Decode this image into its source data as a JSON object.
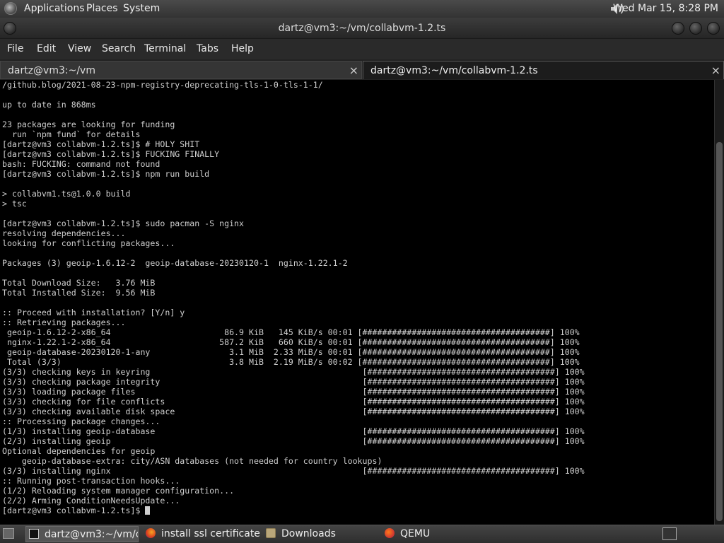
{
  "top_panel": {
    "menus": [
      "Applications",
      "Places",
      "System"
    ],
    "clock": "Wed Mar 15,  8:28 PM"
  },
  "window": {
    "title": "dartz@vm3:~/vm/collabvm-1.2.ts"
  },
  "menubar": [
    "File",
    "Edit",
    "View",
    "Search",
    "Terminal",
    "Tabs",
    "Help"
  ],
  "tabs": [
    {
      "label": "dartz@vm3:~/vm",
      "close": "×"
    },
    {
      "label": "dartz@vm3:~/vm/collabvm-1.2.ts",
      "close": "×"
    }
  ],
  "terminal": {
    "lines": [
      "/github.blog/2021-08-23-npm-registry-deprecating-tls-1-0-tls-1-1/",
      "",
      "up to date in 868ms",
      "",
      "23 packages are looking for funding",
      "  run `npm fund` for details",
      "[dartz@vm3 collabvm-1.2.ts]$ # HOLY SHIT",
      "[dartz@vm3 collabvm-1.2.ts]$ FUCKING FINALLY",
      "bash: FUCKING: command not found",
      "[dartz@vm3 collabvm-1.2.ts]$ npm run build",
      "",
      "> collabvm1.ts@1.0.0 build",
      "> tsc",
      "",
      "[dartz@vm3 collabvm-1.2.ts]$ sudo pacman -S nginx",
      "resolving dependencies...",
      "looking for conflicting packages...",
      "",
      "Packages (3) geoip-1.6.12-2  geoip-database-20230120-1  nginx-1.22.1-2",
      "",
      "Total Download Size:   3.76 MiB",
      "Total Installed Size:  9.56 MiB",
      "",
      ":: Proceed with installation? [Y/n] y",
      ":: Retrieving packages...",
      " geoip-1.6.12-2-x86_64                       86.9 KiB   145 KiB/s 00:01 [######################################] 100%",
      " nginx-1.22.1-2-x86_64                      587.2 KiB   660 KiB/s 00:01 [######################################] 100%",
      " geoip-database-20230120-1-any                3.1 MiB  2.33 MiB/s 00:01 [######################################] 100%",
      " Total (3/3)                                  3.8 MiB  2.19 MiB/s 00:02 [######################################] 100%",
      "(3/3) checking keys in keyring                                           [######################################] 100%",
      "(3/3) checking package integrity                                         [######################################] 100%",
      "(3/3) loading package files                                              [######################################] 100%",
      "(3/3) checking for file conflicts                                        [######################################] 100%",
      "(3/3) checking available disk space                                      [######################################] 100%",
      ":: Processing package changes...",
      "(1/3) installing geoip-database                                          [######################################] 100%",
      "(2/3) installing geoip                                                   [######################################] 100%",
      "Optional dependencies for geoip",
      "    geoip-database-extra: city/ASN databases (not needed for country lookups)",
      "(3/3) installing nginx                                                   [######################################] 100%",
      ":: Running post-transaction hooks...",
      "(1/2) Reloading system manager configuration...",
      "(2/2) Arming ConditionNeedsUpdate...",
      "[dartz@vm3 collabvm-1.2.ts]$ "
    ]
  },
  "taskbar": {
    "items": [
      {
        "label": "dartz@vm3:~/vm/c...",
        "icon": "terminal-icon"
      },
      {
        "label": "install ssl certificate ...",
        "icon": "firefox-icon"
      },
      {
        "label": "Downloads",
        "icon": "folder-icon"
      },
      {
        "label": "QEMU",
        "icon": "qemu-icon"
      }
    ]
  }
}
